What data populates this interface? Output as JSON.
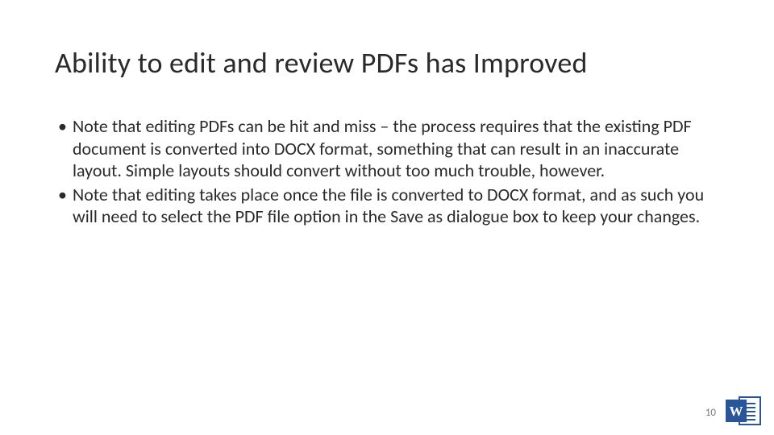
{
  "slide": {
    "title": "Ability to edit and review PDFs has Improved",
    "bullets": [
      "Note that editing PDFs can be hit and miss – the process requires that the existing PDF document is converted into DOCX format, something that can result in an inaccurate layout. Simple layouts should convert without too much trouble, however.",
      "Note that editing takes place once the file is converted to DOCX format, and as such you will need to select the PDF file option in the Save as dialogue box to keep your changes."
    ],
    "page_number": "10",
    "app_icon_letter": "W"
  }
}
